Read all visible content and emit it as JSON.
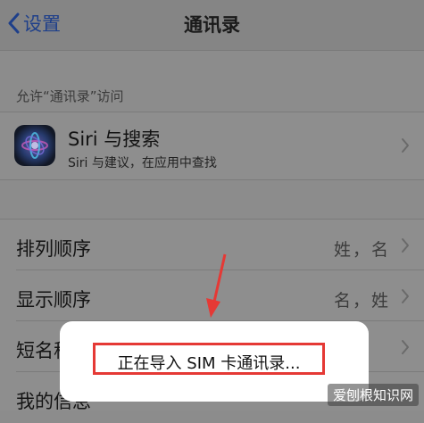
{
  "navbar": {
    "back_label": "设置",
    "title": "通讯录"
  },
  "section_header": "允许“通讯录”访问",
  "siri_row": {
    "title": "Siri 与搜索",
    "subtitle": "Siri 与建议，在应用中查找"
  },
  "rows": [
    {
      "label": "排列顺序",
      "value": "姓，名"
    },
    {
      "label": "显示顺序",
      "value": "名，姓"
    },
    {
      "label": "短名称",
      "value": ""
    },
    {
      "label": "我的信息",
      "value": ""
    }
  ],
  "toast": {
    "text": "正在导入 SIM 卡通讯录..."
  },
  "colors": {
    "highlight": "#e53935",
    "accent": "#1e3f8a"
  },
  "watermark": "爱刨根知识网"
}
